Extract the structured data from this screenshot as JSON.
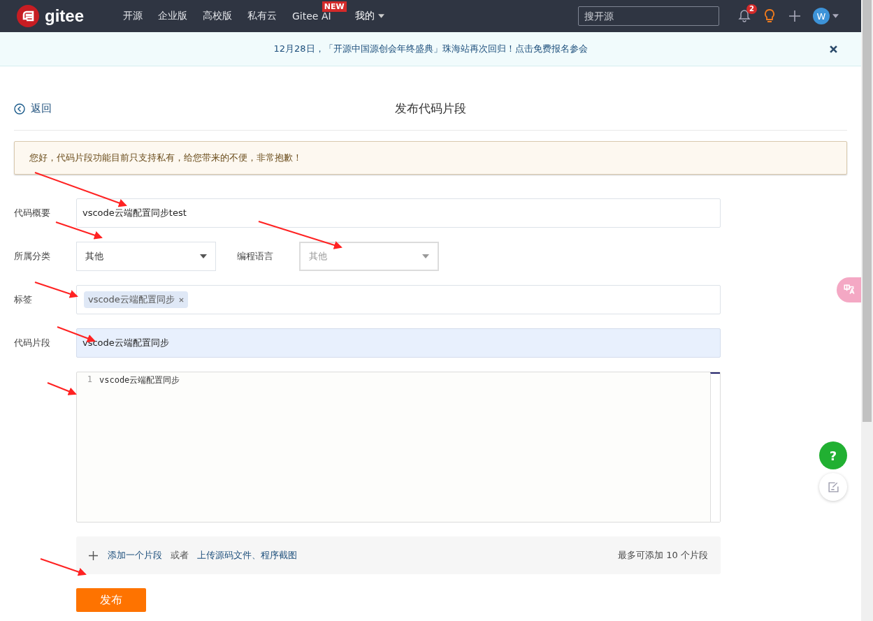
{
  "navbar": {
    "logo_text": "gitee",
    "items": [
      {
        "label": "开源",
        "dropdown": false
      },
      {
        "label": "企业版",
        "dropdown": false
      },
      {
        "label": "高校版",
        "dropdown": false
      },
      {
        "label": "私有云",
        "dropdown": false
      },
      {
        "label": "Gitee AI",
        "badge": "NEW",
        "dropdown": false
      },
      {
        "label": "我的",
        "dropdown": true
      }
    ],
    "search": {
      "placeholder": "搜开源"
    },
    "notification_count": "2",
    "avatar_letter": "W"
  },
  "banner": {
    "text": "12月28日，「开源中国源创会年终盛典」珠海站再次回归！点击免费报名参会"
  },
  "page": {
    "back": "返回",
    "title": "发布代码片段"
  },
  "alert": "您好，代码片段功能目前只支持私有，给您带来的不便，非常抱歉！",
  "form": {
    "summary": {
      "label": "代码概要",
      "value": "vscode云端配置同步test"
    },
    "category": {
      "label": "所属分类",
      "value": "其他",
      "disabled": false
    },
    "language": {
      "label": "编程语言",
      "value": "其他",
      "disabled": true
    },
    "tags": {
      "label": "标签",
      "items": [
        "vscode云端配置同步"
      ]
    },
    "snippet": {
      "label": "代码片段",
      "filename": "vscode云端配置同步",
      "lines": [
        {
          "number": "1",
          "code": "vscode云端配置同步"
        }
      ]
    },
    "add": {
      "add_link": "添加一个片段",
      "or": "或者",
      "upload_link": "上传源码文件、程序截图",
      "limit": "最多可添加 10 个片段"
    },
    "submit": "发布"
  },
  "help_button": "?"
}
